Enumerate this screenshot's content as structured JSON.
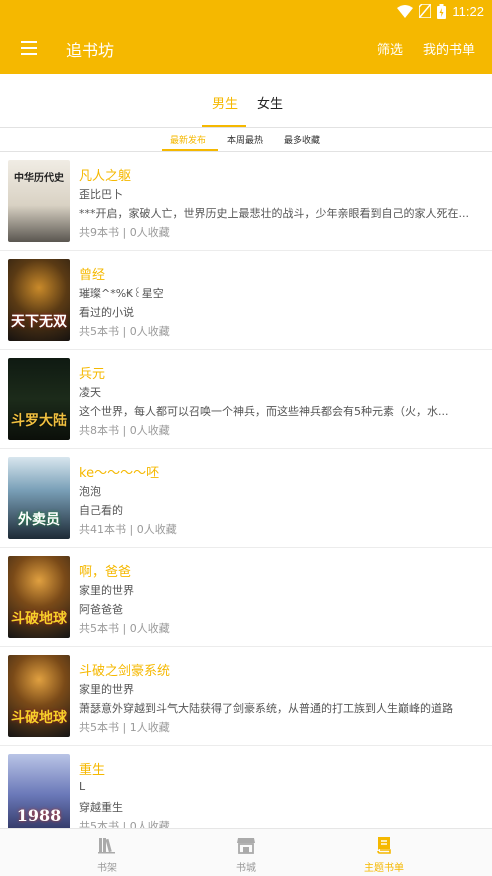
{
  "status_bar": {
    "time": "11:22"
  },
  "app_bar": {
    "title": "追书坊",
    "actions": {
      "filter": "筛选",
      "my_books": "我的书单"
    }
  },
  "gender_tabs": {
    "male": "男生",
    "female": "女生",
    "selected": "男生"
  },
  "sort_tabs": {
    "newest": "最新发布",
    "weekly_hot": "本周最热",
    "most_collected": "最多收藏",
    "selected": "最新发布"
  },
  "books": [
    {
      "title": "凡人之躯",
      "author": "歪比巴卜",
      "desc": "***开启，家破人亡，世界历史上最悲壮的战斗，少年亲眼看到自己的家人死在...",
      "meta": "共9本书 | 0人收藏",
      "cover_text": "中华历代史"
    },
    {
      "title": "曾经",
      "author": "璀璨^*%₭꒰星空",
      "desc": "看过的小说",
      "meta": "共5本书 | 0人收藏",
      "cover_text": "天下无双"
    },
    {
      "title": "兵元",
      "author": "凌天",
      "desc": "这个世界，每人都可以召唤一个神兵，而这些神兵都会有5种元素（火，水...",
      "meta": "共8本书 | 0人收藏",
      "cover_text": "斗罗大陆"
    },
    {
      "title": "ke～～～～呸",
      "author": "泡泡",
      "desc": "自己看的",
      "meta": "共41本书 | 0人收藏",
      "cover_text": "外卖员"
    },
    {
      "title": "啊，爸爸",
      "author": "家里的世界",
      "desc": "阿爸爸爸",
      "meta": "共5本书 | 0人收藏",
      "cover_text": "斗破地球"
    },
    {
      "title": "斗破之剑豪系统",
      "author": "家里的世界",
      "desc": "萧瑟意外穿越到斗气大陆获得了剑豪系统，从普通的打工族到人生巅峰的道路",
      "meta": "共5本书 | 1人收藏",
      "cover_text": "斗破地球"
    },
    {
      "title": "重生",
      "author": "L",
      "desc": "穿越重生",
      "meta": "共5本书 | 0人收藏",
      "cover_text": "1988"
    }
  ],
  "bottom_nav": {
    "bookshelf": "书架",
    "bookstore": "书城",
    "topic_list": "主题书单",
    "selected": "主题书单"
  },
  "colors": {
    "accent": "#f5b800",
    "text": "#333333",
    "muted": "#9a9a9a"
  }
}
